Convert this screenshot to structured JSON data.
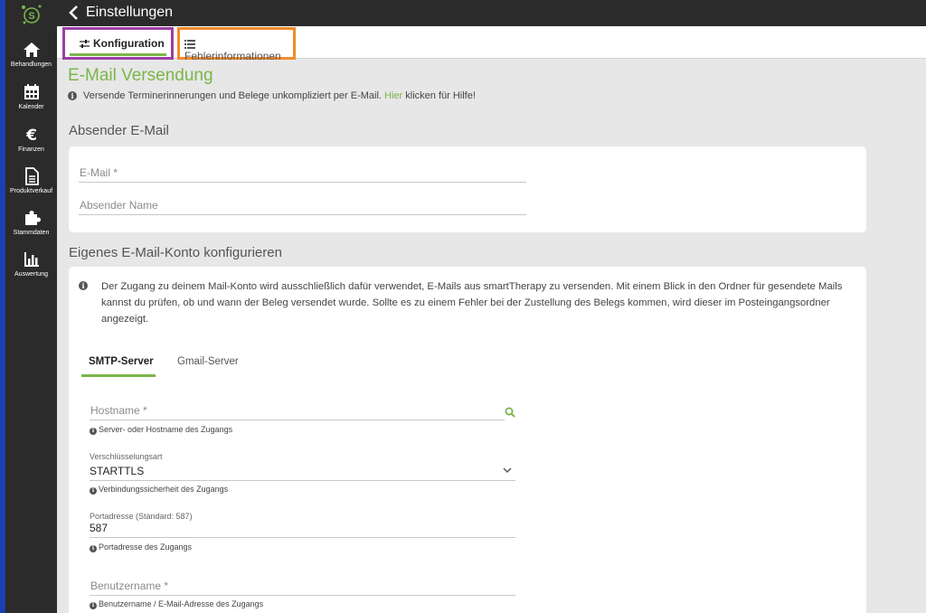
{
  "app": {
    "title": "Einstellungen"
  },
  "sidebar": {
    "items": [
      {
        "label": "Behandlungen",
        "icon": "home-icon"
      },
      {
        "label": "Kalender",
        "icon": "calendar-icon"
      },
      {
        "label": "Finanzen",
        "icon": "euro-icon"
      },
      {
        "label": "Produktverkauf",
        "icon": "document-icon"
      },
      {
        "label": "Stammdaten",
        "icon": "puzzle-icon"
      },
      {
        "label": "Auswertung",
        "icon": "bar-chart-icon"
      }
    ]
  },
  "tabs": [
    {
      "label": "Konfiguration",
      "icon": "sliders-icon",
      "active": true
    },
    {
      "label": "Fehlerinformationen",
      "icon": "list-icon",
      "active": false
    }
  ],
  "email_section": {
    "title": "E-Mail Versendung",
    "help_text": "Versende Terminerinnerungen und Belege unkompliziert per E-Mail.",
    "help_link": "Hier",
    "help_suffix": "klicken für Hilfe!"
  },
  "sender": {
    "title": "Absender E-Mail",
    "email_placeholder": "E-Mail *",
    "name_placeholder": "Absender Name"
  },
  "account": {
    "title": "Eigenes E-Mail-Konto konfigurieren",
    "info": "Der Zugang zu deinem Mail-Konto wird ausschließlich dafür verwendet, E-Mails aus smartTherapy zu versenden. Mit einem Blick in den Ordner für gesendete Mails kannst du prüfen, ob und wann der Beleg versendet wurde. Sollte es zu einem Fehler bei der Zustellung des Belegs kommen, wird dieser im Posteingangsordner angezeigt.",
    "server_tabs": [
      {
        "label": "SMTP-Server",
        "active": true
      },
      {
        "label": "Gmail-Server",
        "active": false
      }
    ],
    "hostname": {
      "placeholder": "Hostname *",
      "hint": "Server- oder Hostname des Zugangs"
    },
    "encryption": {
      "label": "Verschlüsselungsart",
      "value": "STARTTLS",
      "hint": "Verbindungssicherheit des Zugangs"
    },
    "port": {
      "label": "Portadresse (Standard: 587)",
      "value": "587",
      "hint": "Portadresse des Zugangs"
    },
    "username": {
      "placeholder": "Benutzername *",
      "hint": "Benutzername / E-Mail-Adresse des Zugangs"
    }
  },
  "colors": {
    "accent": "#7ab648",
    "sidebar": "#2b2b2b",
    "highlight_purple": "#9b3ea5",
    "highlight_orange": "#f28a2b"
  }
}
